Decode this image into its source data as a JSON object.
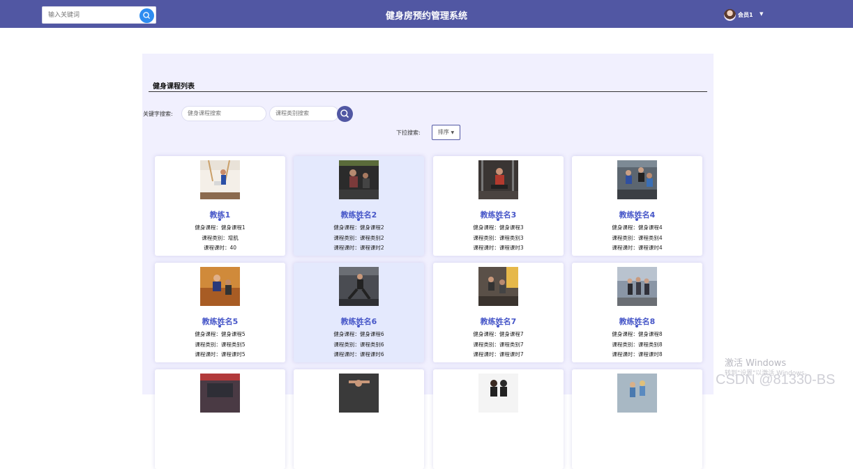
{
  "header": {
    "search_placeholder": "输入关键词",
    "title": "健身房预约管理系统",
    "username": "会员1"
  },
  "section": {
    "title": "健身课程列表",
    "keyword_label": "关键字搜索:",
    "course_placeholder": "健身课程搜索",
    "category_placeholder": "课程类别搜索",
    "dropdown_label": "下拉搜索:",
    "sort_label": "排序"
  },
  "cards": [
    {
      "name": "教练1",
      "line1": "健身课程：健身课程1",
      "line2": "课程类别：增肌",
      "line3": "课程课时：40"
    },
    {
      "name": "教练姓名2",
      "line1": "健身课程：健身课程2",
      "line2": "课程类别：课程类别2",
      "line3": "课程课时：课程课时2"
    },
    {
      "name": "教练姓名3",
      "line1": "健身课程：健身课程3",
      "line2": "课程类别：课程类别3",
      "line3": "课程课时：课程课时3"
    },
    {
      "name": "教练姓名4",
      "line1": "健身课程：健身课程4",
      "line2": "课程类别：课程类别4",
      "line3": "课程课时：课程课时4"
    },
    {
      "name": "教练姓名5",
      "line1": "健身课程：健身课程5",
      "line2": "课程类别：课程类别5",
      "line3": "课程课时：课程课时5"
    },
    {
      "name": "教练姓名6",
      "line1": "健身课程：健身课程6",
      "line2": "课程类别：课程类别6",
      "line3": "课程课时：课程课时6"
    },
    {
      "name": "教练姓名7",
      "line1": "健身课程：健身课程7",
      "line2": "课程类别：课程类别7",
      "line3": "课程课时：课程课时7"
    },
    {
      "name": "教练姓名8",
      "line1": "健身课程：健身课程8",
      "line2": "课程类别：课程类别8",
      "line3": "课程课时：课程课时8"
    }
  ],
  "overlay": {
    "windows_activate": "激活 Windows",
    "windows_hint": "转到\"设置\"以激活 Windows。",
    "csdn_watermark": "CSDN @81330-BS"
  },
  "colors": {
    "header_bg": "#5157a3",
    "accent": "#4656c8",
    "panel_bg": "#f1f0fe",
    "search_button": "#2d8cf0"
  }
}
